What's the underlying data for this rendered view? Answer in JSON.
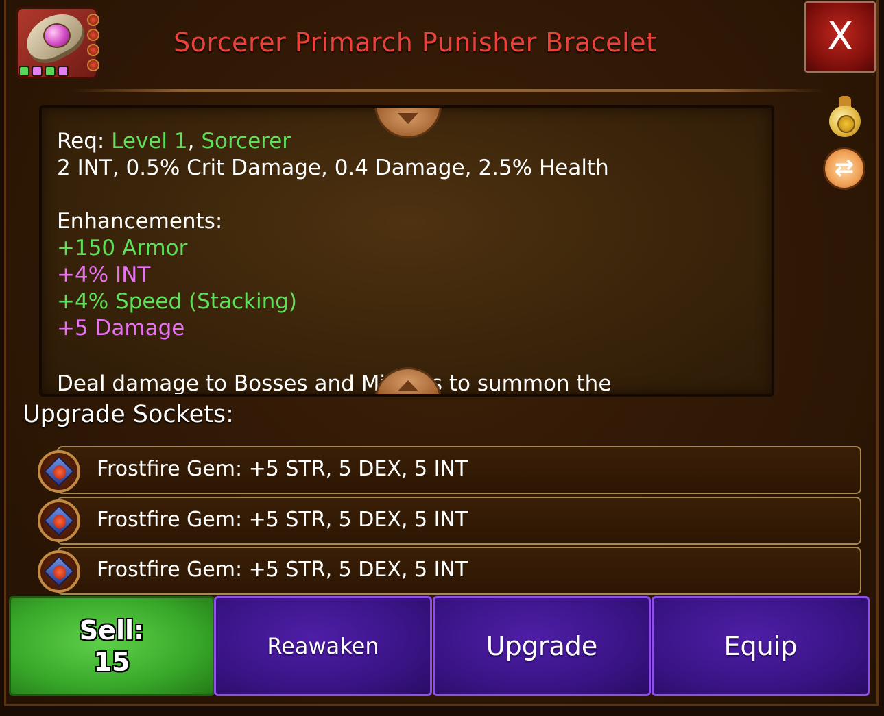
{
  "item": {
    "title": "Sorcerer Primarch Punisher Bracelet",
    "icon": "bracelet-icon",
    "icon_socket_colors": [
      "#59d65a",
      "#e27ef0",
      "#59d65a",
      "#e27ef0"
    ]
  },
  "header": {
    "close_label": "X",
    "coin_bag_icon": "coin-bag-icon",
    "swap_icon": "swap-arrows-icon"
  },
  "description": {
    "req_label": "Req: ",
    "req_level": "Level 1",
    "req_sep": ", ",
    "req_class": "Sorcerer",
    "stats": "2 INT, 0.5% Crit Damage, 0.4 Damage, 2.5% Health",
    "enhancements_heading": "Enhancements:",
    "enhancements": [
      {
        "text": "+150 Armor",
        "color": "#5fe05a"
      },
      {
        "text": "+4% INT",
        "color": "#e772f0"
      },
      {
        "text": "+4% Speed (Stacking)",
        "color": "#5fe05a"
      },
      {
        "text": "+5 Damage",
        "color": "#e772f0"
      }
    ],
    "passive_partial": "Deal damage to Bosses and Minions to summon the"
  },
  "sockets": {
    "heading": "Upgrade Sockets:",
    "rows": [
      {
        "text": "Frostfire Gem: +5 STR, 5 DEX, 5 INT",
        "icon": "frostfire-gem-icon"
      },
      {
        "text": "Frostfire Gem: +5 STR, 5 DEX, 5 INT",
        "icon": "frostfire-gem-icon"
      },
      {
        "text": "Frostfire Gem: +5 STR, 5 DEX, 5 INT",
        "icon": "frostfire-gem-icon"
      }
    ]
  },
  "actions": {
    "sell_label": "Sell:",
    "sell_value": "15",
    "reawaken_label": "Reawaken",
    "upgrade_label": "Upgrade",
    "equip_label": "Equip"
  },
  "colors": {
    "title": "#e8433a",
    "green_text": "#5fe05a",
    "pink_text": "#e772f0",
    "sell_button": "#38a82a",
    "action_button": "#3a1486",
    "close_button": "#a8140e"
  }
}
